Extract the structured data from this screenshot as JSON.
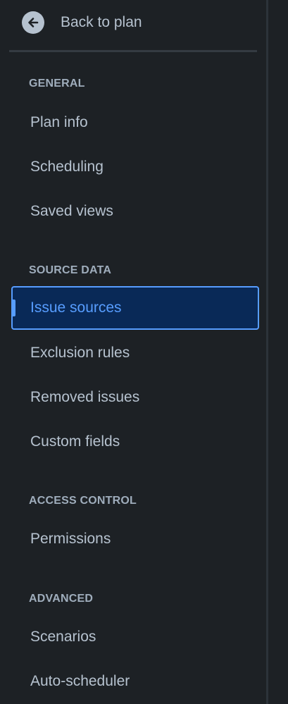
{
  "back": {
    "label": "Back to plan",
    "icon": "arrow-left-icon"
  },
  "sections": {
    "general": {
      "heading": "GENERAL",
      "items": [
        "Plan info",
        "Scheduling",
        "Saved views"
      ]
    },
    "source_data": {
      "heading": "SOURCE DATA",
      "items": [
        "Issue sources",
        "Exclusion rules",
        "Removed issues",
        "Custom fields"
      ],
      "selected": "Issue sources"
    },
    "access_control": {
      "heading": "ACCESS CONTROL",
      "items": [
        "Permissions"
      ]
    },
    "advanced": {
      "heading": "ADVANCED",
      "items": [
        "Scenarios",
        "Auto-scheduler"
      ]
    }
  },
  "colors": {
    "background": "#1d2125",
    "text": "#b6c2cf",
    "heading": "#9fadbc",
    "selected_bg": "#092957",
    "selected_accent": "#579dff"
  }
}
